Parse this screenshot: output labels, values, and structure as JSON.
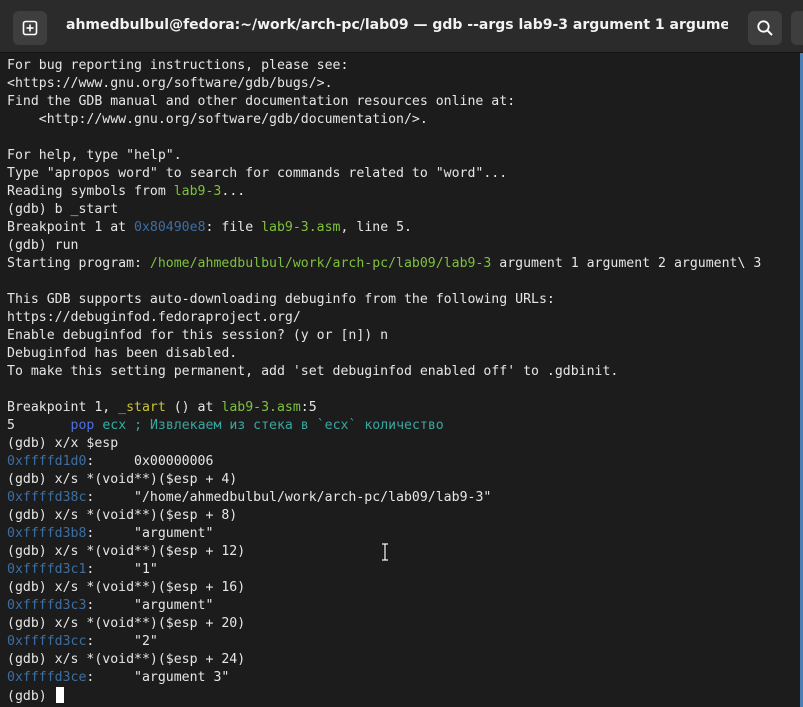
{
  "window": {
    "title": "ahmedbulbul@fedora:~/work/arch-pc/lab09 — gdb --args lab9-3 argument 1 argument 2 argu...",
    "buttons": {
      "new_tab_icon": "new-tab-icon",
      "search_icon": "search-icon",
      "menu_icon": "hamburger-menu-icon"
    }
  },
  "colors": {
    "terminal_bg": "#1c1c1c",
    "text": "#e6e6e6",
    "address": "#3d6fa3",
    "path_green": "#7ec13d",
    "function_yellow": "#c9c13b",
    "keyword": "#4f6fe0",
    "comment": "#3aa6a0"
  },
  "terminal": {
    "lines": [
      {
        "segments": [
          {
            "t": "For bug reporting instructions, please see:",
            "c": ""
          }
        ]
      },
      {
        "segments": [
          {
            "t": "<https://www.gnu.org/software/gdb/bugs/>.",
            "c": ""
          }
        ]
      },
      {
        "segments": [
          {
            "t": "Find the GDB manual and other documentation resources online at:",
            "c": ""
          }
        ]
      },
      {
        "segments": [
          {
            "t": "    <http://www.gnu.org/software/gdb/documentation/>.",
            "c": ""
          }
        ]
      },
      {
        "segments": [
          {
            "t": "",
            "c": ""
          }
        ]
      },
      {
        "segments": [
          {
            "t": "For help, type \"help\".",
            "c": ""
          }
        ]
      },
      {
        "segments": [
          {
            "t": "Type \"apropos word\" to search for commands related to \"word\"...",
            "c": ""
          }
        ]
      },
      {
        "segments": [
          {
            "t": "Reading symbols from ",
            "c": ""
          },
          {
            "t": "lab9-3",
            "c": "green"
          },
          {
            "t": "...",
            "c": ""
          }
        ]
      },
      {
        "segments": [
          {
            "t": "(gdb) b _start",
            "c": ""
          }
        ]
      },
      {
        "segments": [
          {
            "t": "Breakpoint 1 at ",
            "c": ""
          },
          {
            "t": "0x80490e8",
            "c": "addr"
          },
          {
            "t": ": file ",
            "c": ""
          },
          {
            "t": "lab9-3.asm",
            "c": "green"
          },
          {
            "t": ", line 5.",
            "c": ""
          }
        ]
      },
      {
        "segments": [
          {
            "t": "(gdb) run",
            "c": ""
          }
        ]
      },
      {
        "segments": [
          {
            "t": "Starting program: ",
            "c": ""
          },
          {
            "t": "/home/ahmedbulbul/work/arch-pc/lab09/lab9-3",
            "c": "green"
          },
          {
            "t": " argument 1 argument 2 argument\\ 3",
            "c": ""
          }
        ]
      },
      {
        "segments": [
          {
            "t": "",
            "c": ""
          }
        ]
      },
      {
        "segments": [
          {
            "t": "This GDB supports auto-downloading debuginfo from the following URLs:",
            "c": ""
          }
        ]
      },
      {
        "segments": [
          {
            "t": "https://debuginfod.fedoraproject.org/",
            "c": ""
          }
        ]
      },
      {
        "segments": [
          {
            "t": "Enable debuginfod for this session? (y or [n]) n",
            "c": ""
          }
        ]
      },
      {
        "segments": [
          {
            "t": "Debuginfod has been disabled.",
            "c": ""
          }
        ]
      },
      {
        "segments": [
          {
            "t": "To make this setting permanent, add 'set debuginfod enabled off' to .gdbinit.",
            "c": ""
          }
        ]
      },
      {
        "segments": [
          {
            "t": "",
            "c": ""
          }
        ]
      },
      {
        "segments": [
          {
            "t": "Breakpoint 1, ",
            "c": ""
          },
          {
            "t": "_start",
            "c": "yellow"
          },
          {
            "t": " () at ",
            "c": ""
          },
          {
            "t": "lab9-3.asm",
            "c": "green"
          },
          {
            "t": ":5",
            "c": ""
          }
        ]
      },
      {
        "segments": [
          {
            "t": "5       ",
            "c": ""
          },
          {
            "t": "pop",
            "c": "kw"
          },
          {
            "t": " ",
            "c": ""
          },
          {
            "t": "ecx",
            "c": "reg"
          },
          {
            "t": " ; Извлекаем из стека в `ecx` количество",
            "c": "cmt"
          }
        ]
      },
      {
        "segments": [
          {
            "t": "(gdb) x/x $esp",
            "c": ""
          }
        ]
      },
      {
        "segments": [
          {
            "t": "0xffffd1d0",
            "c": "addr"
          },
          {
            "t": ":     0x00000006",
            "c": ""
          }
        ]
      },
      {
        "segments": [
          {
            "t": "(gdb) x/s *(void**)($esp + 4)",
            "c": ""
          }
        ]
      },
      {
        "segments": [
          {
            "t": "0xffffd38c",
            "c": "addr"
          },
          {
            "t": ":     \"/home/ahmedbulbul/work/arch-pc/lab09/lab9-3\"",
            "c": ""
          }
        ]
      },
      {
        "segments": [
          {
            "t": "(gdb) x/s *(void**)($esp + 8)",
            "c": ""
          }
        ]
      },
      {
        "segments": [
          {
            "t": "0xffffd3b8",
            "c": "addr"
          },
          {
            "t": ":     \"argument\"",
            "c": ""
          }
        ]
      },
      {
        "segments": [
          {
            "t": "(gdb) x/s *(void**)($esp + 12)",
            "c": ""
          }
        ]
      },
      {
        "segments": [
          {
            "t": "0xffffd3c1",
            "c": "addr"
          },
          {
            "t": ":     \"1\"",
            "c": ""
          }
        ]
      },
      {
        "segments": [
          {
            "t": "(gdb) x/s *(void**)($esp + 16)",
            "c": ""
          }
        ]
      },
      {
        "segments": [
          {
            "t": "0xffffd3c3",
            "c": "addr"
          },
          {
            "t": ":     \"argument\"",
            "c": ""
          }
        ]
      },
      {
        "segments": [
          {
            "t": "(gdb) x/s *(void**)($esp + 20)",
            "c": ""
          }
        ]
      },
      {
        "segments": [
          {
            "t": "0xffffd3cc",
            "c": "addr"
          },
          {
            "t": ":     \"2\"",
            "c": ""
          }
        ]
      },
      {
        "segments": [
          {
            "t": "(gdb) x/s *(void**)($esp + 24)",
            "c": ""
          }
        ]
      },
      {
        "segments": [
          {
            "t": "0xffffd3ce",
            "c": "addr"
          },
          {
            "t": ":     \"argument 3\"",
            "c": ""
          }
        ]
      }
    ],
    "prompt": "(gdb) "
  }
}
